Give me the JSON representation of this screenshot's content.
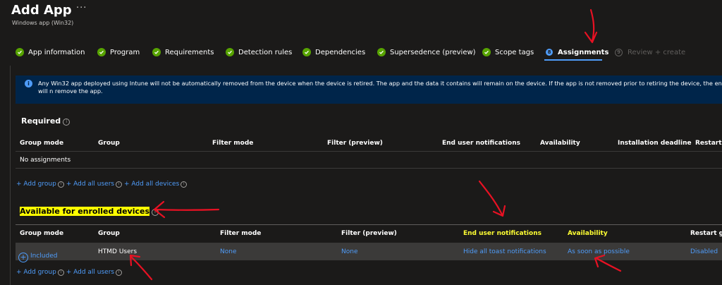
{
  "header": {
    "title": "Add App",
    "more": "···",
    "subtitle": "Windows app (Win32)"
  },
  "steps": [
    {
      "label": "App information",
      "state": "complete"
    },
    {
      "label": "Program",
      "state": "complete"
    },
    {
      "label": "Requirements",
      "state": "complete"
    },
    {
      "label": "Detection rules",
      "state": "complete"
    },
    {
      "label": "Dependencies",
      "state": "complete"
    },
    {
      "label": "Supersedence (preview)",
      "state": "complete"
    },
    {
      "label": "Scope tags",
      "state": "complete"
    },
    {
      "label": "Assignments",
      "number": "8",
      "state": "current"
    },
    {
      "label": "Review + create",
      "number": "9",
      "state": "disabled"
    }
  ],
  "banner": {
    "icon": "info-icon",
    "text": "Any Win32 app deployed using Intune will not be automatically removed from the device when the device is retired. The app and the data it contains will remain on the device. If the app is not removed prior to retiring the device, the end user will n remove the app."
  },
  "required": {
    "title": "Required",
    "columns": [
      "Group mode",
      "Group",
      "Filter mode",
      "Filter (preview)",
      "End user notifications",
      "Availability",
      "Installation deadline",
      "Restart g"
    ],
    "empty_text": "No assignments",
    "links": [
      "+ Add group",
      "+ Add all users",
      "+ Add all devices"
    ]
  },
  "available": {
    "title": "Available for enrolled devices",
    "columns": [
      "Group mode",
      "Group",
      "Filter mode",
      "Filter (preview)",
      "End user notifications",
      "Availability",
      "Restart gr"
    ],
    "row": {
      "group_mode": "Included",
      "group": "HTMD Users",
      "filter_mode": "None",
      "filter": "None",
      "notifications": "Hide all toast notifications",
      "availability": "As soon as possible",
      "restart": "Disabled"
    },
    "links": [
      "+ Add group",
      "+ Add all users"
    ]
  },
  "colors": {
    "background": "#1b1a19",
    "accent": "#4f9cf9",
    "success": "#57a300",
    "highlight": "#ffff00",
    "annotation": "#e81123"
  }
}
